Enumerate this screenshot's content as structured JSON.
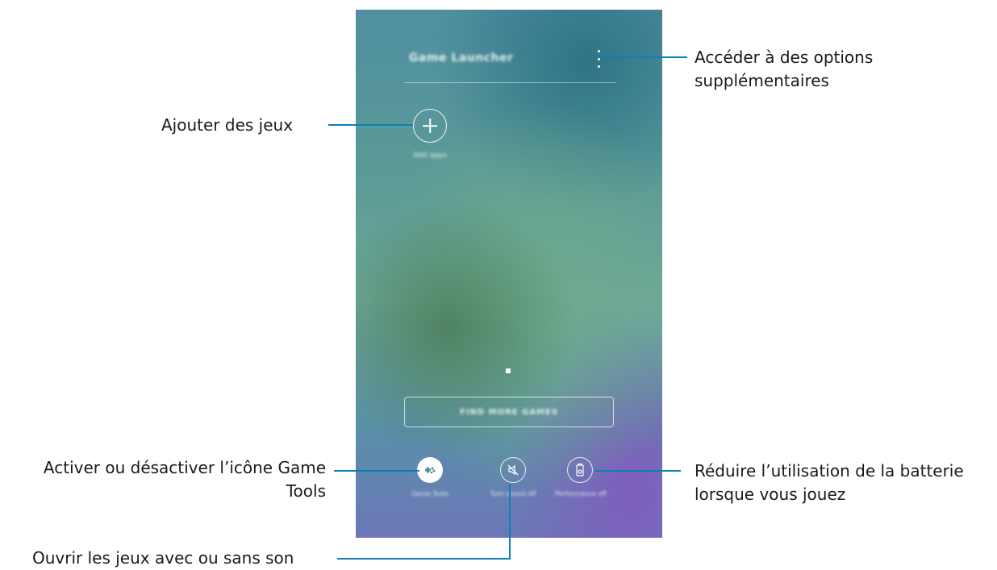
{
  "screen": {
    "app_title": "Game Launcher",
    "add_apps_label": "Add apps",
    "find_more_games": "FIND MORE GAMES",
    "tools": [
      {
        "label": "Game Tools",
        "icon": "game-tools-icon"
      },
      {
        "label": "Turn sound off",
        "icon": "mute-icon"
      },
      {
        "label": "Performance off",
        "icon": "battery-icon"
      }
    ]
  },
  "callouts": {
    "more_options": "Accéder à des options supplémentaires",
    "add_games": "Ajouter des jeux",
    "game_tools": "Activer ou désactiver l’icône Game Tools",
    "battery": "Réduire l’utilisation de la batterie lorsque vous jouez",
    "sound": "Ouvrir les jeux avec ou sans son"
  },
  "colors": {
    "callout_line": "#0d7fb8"
  }
}
